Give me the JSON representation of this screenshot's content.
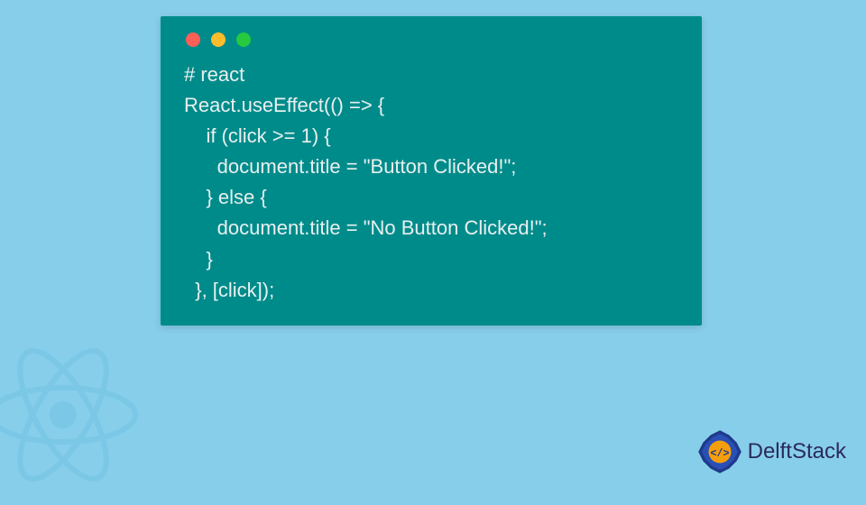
{
  "code": {
    "line1": "# react",
    "line2": "React.useEffect(() => {",
    "line3": "    if (click >= 1) {",
    "line4": "      document.title = \"Button Clicked!\";",
    "line5": "    } else {",
    "line6": "      document.title = \"No Button Clicked!\";",
    "line7": "    }",
    "line8": "  }, [click]);"
  },
  "brand": {
    "name": "DelftStack"
  }
}
